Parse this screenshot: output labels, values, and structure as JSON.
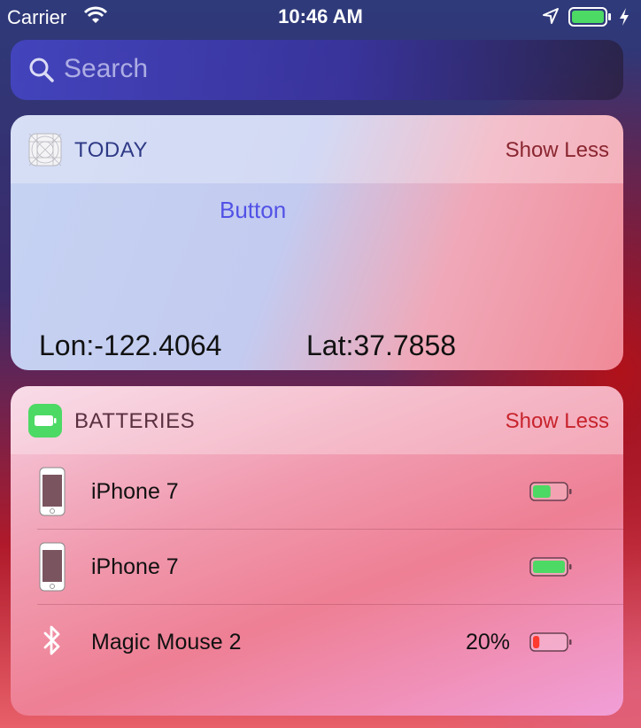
{
  "status_bar": {
    "carrier": "Carrier",
    "time": "10:46 AM",
    "battery_color": "#4cd964"
  },
  "search": {
    "placeholder": "Search"
  },
  "widgets": {
    "today": {
      "title": "TODAY",
      "show_less": "Show Less",
      "button_label": "Button",
      "longitude": "Lon:-122.4064",
      "latitude": "Lat:37.7858"
    },
    "batteries": {
      "title": "BATTERIES",
      "show_less": "Show Less",
      "icon_color": "#4cd964",
      "devices": [
        {
          "name": "iPhone 7",
          "icon": "iphone-icon",
          "percent": "",
          "level": 0.55,
          "color": "#4cd964"
        },
        {
          "name": "iPhone 7",
          "icon": "iphone-icon",
          "percent": "",
          "level": 1.0,
          "color": "#4cd964"
        },
        {
          "name": "Magic Mouse 2",
          "icon": "bluetooth-icon",
          "percent": "20%",
          "level": 0.2,
          "color": "#ff3b30"
        }
      ]
    }
  }
}
